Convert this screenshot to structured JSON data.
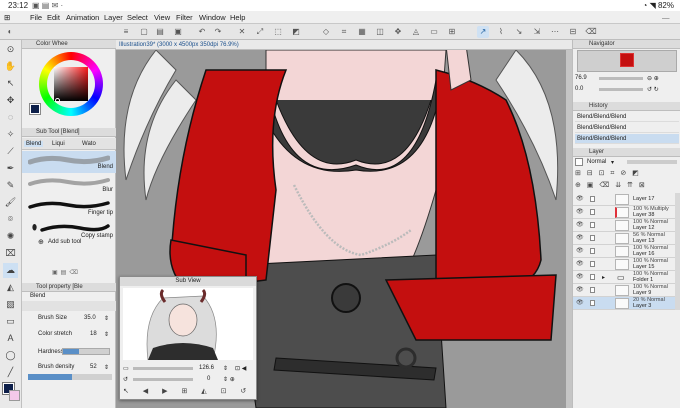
{
  "status_bar": {
    "time": "23:12",
    "battery": "82%"
  },
  "menu": [
    "File",
    "Edit",
    "Animation",
    "Layer",
    "Select",
    "View",
    "Filter",
    "Window",
    "Help"
  ],
  "document": {
    "tab_title": "Illustration39* (3000 x 4500px 350dpi 76.9%)"
  },
  "color_wheel": {
    "title": "Color Whee",
    "current_color": "#0d1f4a"
  },
  "sub_tool": {
    "title": "Sub Tool [Blend]",
    "tabs": [
      "Blend",
      "Liqui",
      "Wato"
    ],
    "brushes": [
      "Blend",
      "Blur",
      "Finger tip",
      "Copy stamp"
    ],
    "add_label": "Add sub tool"
  },
  "tool_property": {
    "title": "Tool property [Ble",
    "tool_name": "Blend",
    "brush_size_label": "Brush Size",
    "brush_size_value": "35.0",
    "color_stretch_label": "Color stretch",
    "color_stretch_value": "18",
    "hardness_label": "Hardness",
    "brush_density_label": "Brush density",
    "brush_density_value": "52"
  },
  "sub_view": {
    "title": "Sub View",
    "zoom": "126.6",
    "angle": "0"
  },
  "navigator": {
    "title": "Navigator",
    "zoom": "76.9",
    "angle": "0.0"
  },
  "history": {
    "title": "History",
    "items": [
      {
        "label": "Blend/Blend/Blend",
        "selected": false
      },
      {
        "label": "Blend/Blend/Blend",
        "selected": false
      },
      {
        "label": "Blend/Blend/Blend",
        "selected": true
      }
    ]
  },
  "layer_panel": {
    "title": "Layer",
    "blend_mode": "Normal",
    "opacity": "100",
    "layers": [
      {
        "mode": "",
        "name": "Layer 17",
        "selected": false
      },
      {
        "mode": "100 % Multiply",
        "name": "Layer 38",
        "selected": false
      },
      {
        "mode": "100 % Normal",
        "name": "Layer 12",
        "selected": false
      },
      {
        "mode": "56 % Normal",
        "name": "Layer 13",
        "selected": false
      },
      {
        "mode": "100 % Normal",
        "name": "Layer 16",
        "selected": false
      },
      {
        "mode": "100 % Normal",
        "name": "Layer 15",
        "selected": false
      },
      {
        "mode": "100 % Normal",
        "name": "Folder 1",
        "selected": false
      },
      {
        "mode": "100 % Normal",
        "name": "Layer 9",
        "selected": false
      },
      {
        "mode": "20 % Normal",
        "name": "Layer 3",
        "selected": true
      }
    ]
  },
  "colors": {
    "accent": "#1d5fa0",
    "jacket_red": "#c40f0f",
    "canvas_bg": "#9a9a9a"
  }
}
